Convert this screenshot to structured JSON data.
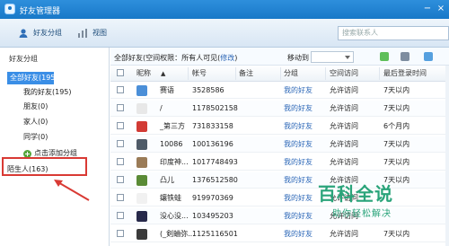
{
  "window": {
    "title": "好友管理器"
  },
  "toolbar": {
    "friend_groups_label": "好友分组",
    "view_label": "视图",
    "search_placeholder": "搜索联系人"
  },
  "sidebar": {
    "title": "好友分组",
    "items": [
      {
        "label": "全部好友(195)"
      },
      {
        "label": "我的好友(195)"
      },
      {
        "label": "朋友(0)"
      },
      {
        "label": "家人(0)"
      },
      {
        "label": "同学(0)"
      },
      {
        "label": "点击添加分组"
      },
      {
        "label": "陌生人(163)"
      }
    ]
  },
  "main": {
    "scope_prefix": "全部好友(空间权限：所有人可见(",
    "scope_link": "修改",
    "scope_suffix": ")",
    "move_label": "移动到",
    "headers": {
      "nickname": "昵称",
      "account": "帐号",
      "remark": "备注",
      "group": "分组",
      "space": "空间访问",
      "last_login": "最后登录时间"
    },
    "rows": [
      {
        "nickname": "赛语",
        "account": "3528586",
        "remark": "",
        "group": "我的好友",
        "space": "允许访问",
        "last_login": "7天以内",
        "avatar_color": "#4b8fd8"
      },
      {
        "nickname": "/",
        "account": "1178502158",
        "remark": "",
        "group": "我的好友",
        "space": "允许访问",
        "last_login": "7天以内",
        "avatar_color": "#e8e8e8"
      },
      {
        "nickname": "_第三方",
        "account": "731833158",
        "remark": "",
        "group": "我的好友",
        "space": "允许访问",
        "last_login": "6个月内",
        "avatar_color": "#d23b35"
      },
      {
        "nickname": "10086",
        "account": "100136196",
        "remark": "",
        "group": "我的好友",
        "space": "允许访问",
        "last_login": "7天以内",
        "avatar_color": "#4f5b68"
      },
      {
        "nickname": "印度神...",
        "account": "1017748493",
        "remark": "",
        "group": "我的好友",
        "space": "允许访问",
        "last_login": "7天以内",
        "avatar_color": "#9a7b57"
      },
      {
        "nickname": "凸儿",
        "account": "1376512580",
        "remark": "",
        "group": "我的好友",
        "space": "允许访问",
        "last_login": "7天以内",
        "avatar_color": "#5a8b36"
      },
      {
        "nickname": "鑲铁蛙",
        "account": "919970369",
        "remark": "",
        "group": "我的好友",
        "space": "允许访问",
        "last_login": "",
        "avatar_color": "#f1f1f1"
      },
      {
        "nickname": "没心没...",
        "account": "103495203",
        "remark": "",
        "group": "我的好友",
        "space": "允许访问",
        "last_login": "",
        "avatar_color": "#27294a"
      },
      {
        "nickname": "(_剣蛐弥...",
        "account": "1125116501",
        "remark": "",
        "group": "我的好友",
        "space": "允许访问",
        "last_login": "7天以内",
        "avatar_color": "#3b3b3b"
      }
    ]
  },
  "watermark": {
    "big": "百科全说",
    "small": "助你轻松解决"
  },
  "colors": {
    "title_bar": "#1878c8",
    "selected": "#3a8ee6",
    "annotation": "#d93a34",
    "watermark": "#2aa47a"
  }
}
